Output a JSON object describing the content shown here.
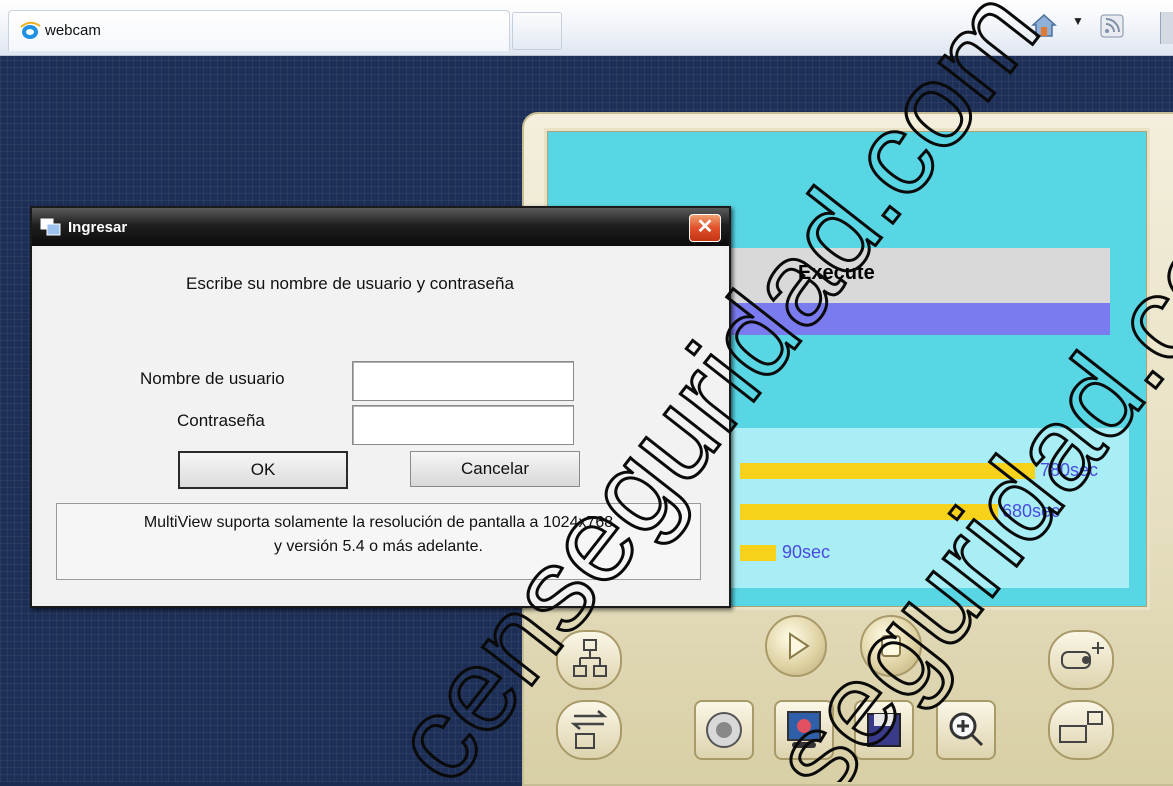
{
  "browser": {
    "tab_title": "webcam",
    "icons": [
      "internet-explorer-icon",
      "home-icon",
      "dropdown-arrow-icon",
      "rss-feed-icon"
    ]
  },
  "player": {
    "column_header": "Execute",
    "timers": [
      {
        "label": "780sec",
        "value": 780
      },
      {
        "label": "680sec",
        "value": 680
      },
      {
        "label": "90sec",
        "value": 90
      }
    ],
    "colors": {
      "screen": "#58d6e4",
      "bar": "#f7d21b",
      "highlight": "#7b7bf0"
    }
  },
  "dialog": {
    "title": "Ingresar",
    "message": "Escribe su nombre de usuario y contraseña",
    "username_label": "Nombre de usuario",
    "username_value": "",
    "password_label": "Contraseña",
    "password_value": "",
    "ok_label": "OK",
    "cancel_label": "Cancelar",
    "info_line1": "MultiView suporta solamente la resolución de pantalla a 1024x768",
    "info_line2": "y versión 5.4 o más adelante."
  },
  "watermark": {
    "text1": "censeguridad.com",
    "text2": "seguridad.com"
  }
}
